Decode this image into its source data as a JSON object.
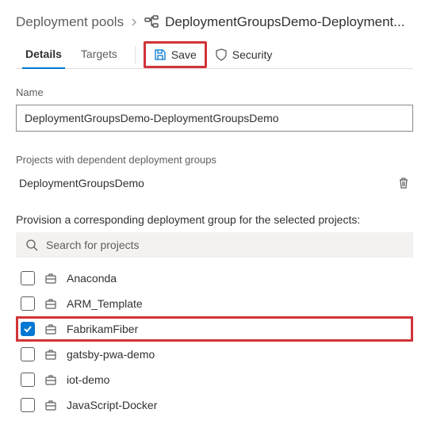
{
  "breadcrumb": {
    "parent": "Deployment pools",
    "current": "DeploymentGroupsDemo-Deployment..."
  },
  "tabs": {
    "details": "Details",
    "targets": "Targets"
  },
  "toolbar": {
    "save": "Save",
    "security": "Security"
  },
  "name_field": {
    "label": "Name",
    "value": "DeploymentGroupsDemo-DeploymentGroupsDemo"
  },
  "dependent": {
    "heading": "Projects with dependent deployment groups",
    "items": [
      "DeploymentGroupsDemo"
    ]
  },
  "provision": {
    "heading": "Provision a corresponding deployment group for the selected projects:",
    "search_placeholder": "Search for projects",
    "projects": [
      {
        "name": "Anaconda",
        "checked": false
      },
      {
        "name": "ARM_Template",
        "checked": false
      },
      {
        "name": "FabrikamFiber",
        "checked": true
      },
      {
        "name": "gatsby-pwa-demo",
        "checked": false
      },
      {
        "name": "iot-demo",
        "checked": false
      },
      {
        "name": "JavaScript-Docker",
        "checked": false
      }
    ]
  }
}
